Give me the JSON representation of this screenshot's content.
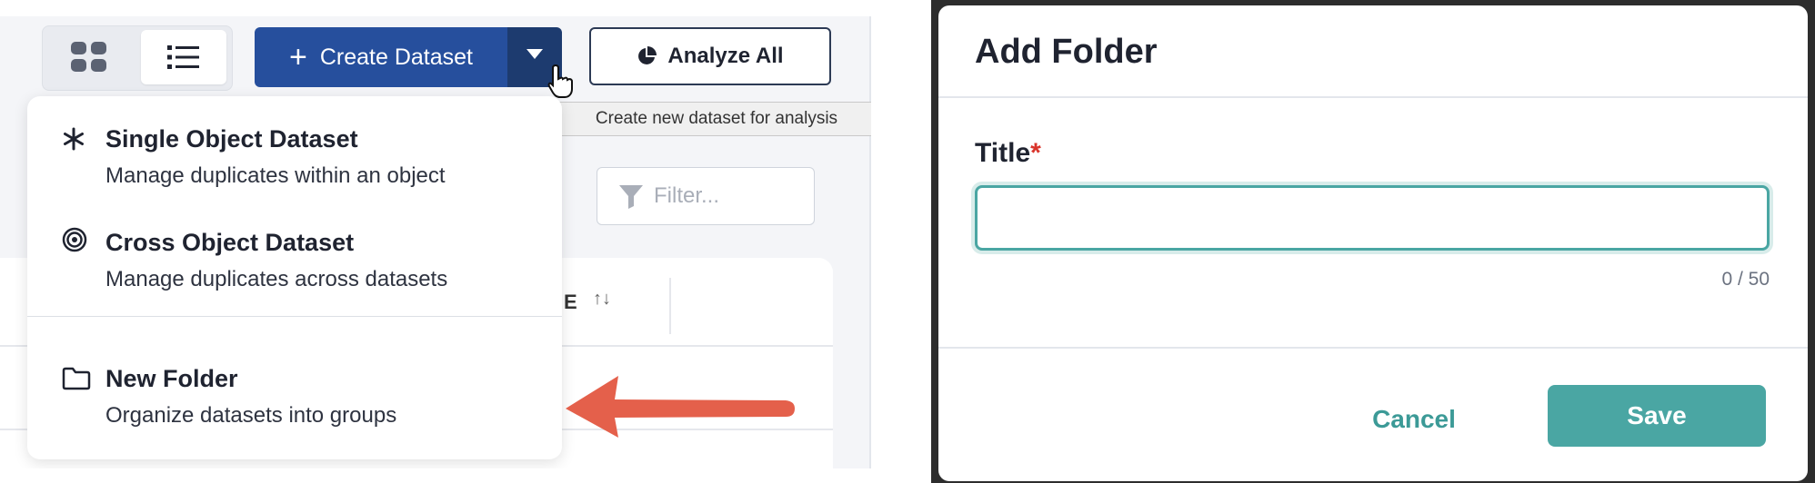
{
  "toolbar": {
    "create_label": "Create Dataset",
    "create_plus": "+",
    "analyze_label": "Analyze All",
    "tooltip": "Create new dataset for analysis"
  },
  "filter": {
    "placeholder": "Filter..."
  },
  "table": {
    "column_header_fragment": "E",
    "sort_glyph": "↑↓"
  },
  "dropdown": {
    "items": [
      {
        "title": "Single Object Dataset",
        "description": "Manage duplicates within an object",
        "icon": "asterisk-icon"
      },
      {
        "title": "Cross Object Dataset",
        "description": "Manage duplicates across datasets",
        "icon": "target-icon"
      },
      {
        "title": "New Folder",
        "description": "Organize datasets into groups",
        "icon": "folder-icon"
      }
    ]
  },
  "modal": {
    "title": "Add Folder",
    "field_label": "Title",
    "required_mark": "*",
    "input_value": "",
    "char_count": "0 / 50",
    "cancel_label": "Cancel",
    "save_label": "Save"
  },
  "colors": {
    "primary_blue": "#264f9d",
    "primary_blue_dark": "#1d3b6f",
    "teal": "#4aa6a3",
    "arrow_red": "#e4604b",
    "required_red": "#d9342b"
  }
}
